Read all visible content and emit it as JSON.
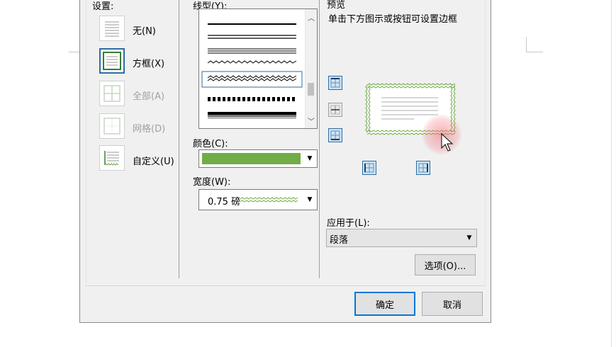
{
  "settings": {
    "label": "设置:",
    "options": [
      {
        "label": "无(N)",
        "state": "normal"
      },
      {
        "label": "方框(X)",
        "state": "selected"
      },
      {
        "label": "全部(A)",
        "state": "disabled"
      },
      {
        "label": "网格(D)",
        "state": "disabled"
      },
      {
        "label": "自定义(U)",
        "state": "normal"
      }
    ]
  },
  "line_style": {
    "label": "线型(Y):",
    "selected_style": "wavy-double"
  },
  "color": {
    "label": "颜色(C):",
    "value": "#70ad47"
  },
  "width": {
    "label": "宽度(W):",
    "value": "0.75 磅"
  },
  "preview": {
    "label": "预览",
    "hint": "单击下方图示或按钮可设置边框",
    "border_color": "#70ad47"
  },
  "apply_to": {
    "label": "应用于(L):",
    "value": "段落"
  },
  "buttons": {
    "options": "选项(O)...",
    "ok": "确定",
    "cancel": "取消"
  }
}
